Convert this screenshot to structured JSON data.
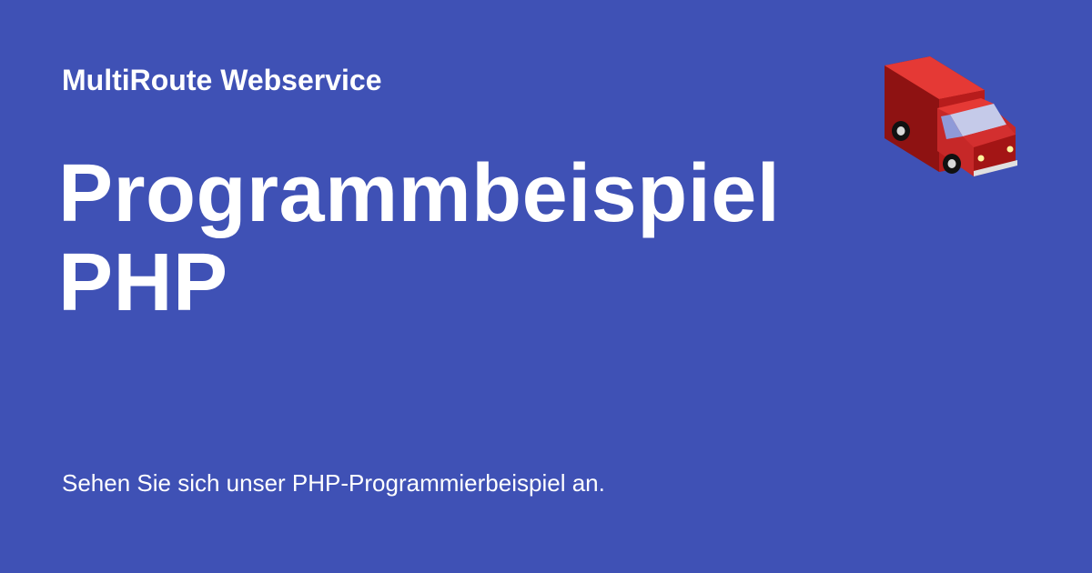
{
  "page": {
    "brand": "MultiRoute Webservice",
    "title_lines": [
      "Programmbeispiel",
      "PHP"
    ],
    "subtitle": "Sehen Sie sich unser PHP-Programmierbeispiel an."
  },
  "icons": {
    "truck": "delivery-truck-icon"
  },
  "colors": {
    "background": "#3F51B5",
    "text": "#FFFFFF",
    "truck_body": "#C62828",
    "truck_roof": "#E53935",
    "truck_window": "#C5CAE9"
  }
}
